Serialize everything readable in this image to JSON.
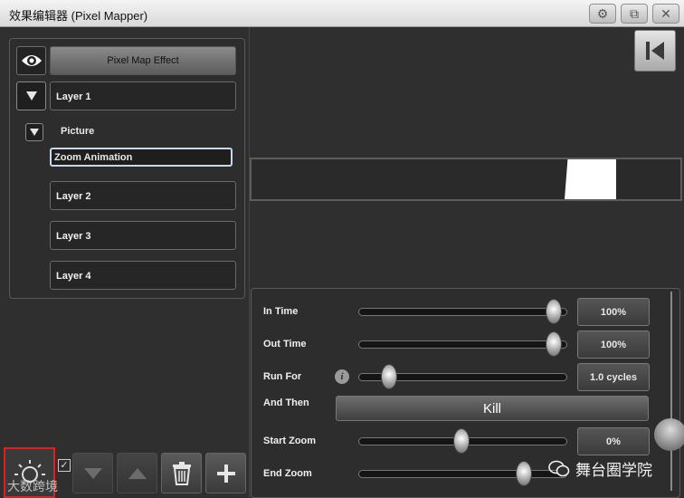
{
  "window": {
    "title": "效果编辑器 (Pixel Mapper)"
  },
  "left_panel": {
    "effect_label": "Pixel Map Effect",
    "layers": [
      "Layer 1",
      "Layer 2",
      "Layer 3",
      "Layer 4"
    ],
    "picture_label": "Picture",
    "selected_item": "Zoom Animation"
  },
  "params": {
    "in_time": {
      "label": "In Time",
      "value": "100%",
      "level": 1.0
    },
    "out_time": {
      "label": "Out Time",
      "value": "100%",
      "level": 1.0
    },
    "run_for": {
      "label": "Run For",
      "value": "1.0 cycles",
      "level": 0.1
    },
    "and_then": {
      "label": "And Then",
      "value": "Kill"
    },
    "start_zoom": {
      "label": "Start Zoom",
      "value": "0%",
      "level": 0.5
    },
    "end_zoom": {
      "label": "End Zoom",
      "level": 0.8
    }
  },
  "watermarks": {
    "left": "大数跨境",
    "right": "舞台圈学院"
  },
  "icons": [
    "gear-icon",
    "restore-icon",
    "close-icon",
    "eye-icon",
    "skip-to-start-icon",
    "info-icon",
    "sun-icon",
    "check-icon",
    "down-arrow-icon",
    "up-arrow-icon",
    "trash-icon",
    "plus-icon",
    "wechat-icon"
  ]
}
